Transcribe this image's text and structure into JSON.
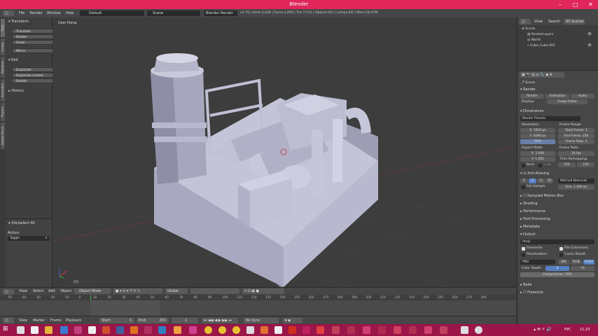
{
  "window": {
    "title": "Blender"
  },
  "topbar": {
    "menus": [
      "File",
      "Render",
      "Window",
      "Help"
    ],
    "layout": "Default",
    "scene": "Scene",
    "engine": "Blender Render",
    "stats": "v2.79 | Verts:3,426 | Faces:3,056 | Tris:7,512 | Objects:0/1 | Lamps:0/0 | Mem:18.47M"
  },
  "left_tabs": [
    "Tools",
    "Create",
    "Relations",
    "Animation",
    "Physics",
    "Grease Pencil"
  ],
  "toolshelf": {
    "transform_header": "Transform",
    "transform_buttons": [
      "Translate",
      "Rotate",
      "Scale"
    ],
    "mirror": "Mirror",
    "edit_header": "Edit",
    "edit_buttons": [
      "Duplicate",
      "Duplicate Linked",
      "Delete"
    ],
    "history_header": "History",
    "operator_header": "(De)select All",
    "action_label": "Action:",
    "action_value": "Toggle"
  },
  "viewport": {
    "label": "User Persp",
    "frame_indicator": "(1)"
  },
  "view3d_header": {
    "menus": [
      "View",
      "Select",
      "Add",
      "Object"
    ],
    "mode": "Object Mode",
    "orientation": "Global"
  },
  "timeline": {
    "ticks": [
      "-50",
      "-40",
      "-30",
      "-20",
      "-10",
      "0",
      "10",
      "20",
      "30",
      "40",
      "50",
      "60",
      "70",
      "80",
      "90",
      "100",
      "110",
      "120",
      "130",
      "140",
      "150",
      "160",
      "170",
      "180",
      "190",
      "200",
      "210",
      "220",
      "230",
      "240",
      "250",
      "260",
      "270",
      "280"
    ],
    "menus": [
      "View",
      "Marker",
      "Frame",
      "Playback"
    ],
    "start": "Start:",
    "start_val": "1",
    "end": "End:",
    "end_val": "250",
    "current": "1",
    "sync": "No Sync"
  },
  "outliner": {
    "menus": [
      "View",
      "Search",
      "All Scenes"
    ],
    "items": [
      "Scene",
      "RenderLayers",
      "World",
      "Cube_Cube.001"
    ]
  },
  "properties": {
    "context": "Scene",
    "render_header": "Render",
    "render_buttons": [
      "Render",
      "Animation",
      "Audio"
    ],
    "display_label": "Display:",
    "display_value": "Image Editor",
    "dimensions_header": "Dimensions",
    "render_presets": "Render Presets",
    "resolution_label": "Resolution:",
    "res_x": "1920 px",
    "res_y": "1080 px",
    "res_pct": "50%",
    "frame_range_label": "Frame Range:",
    "start_frame": "Start Frame:",
    "start_frame_val": "1",
    "end_frame": "End Frame:",
    "end_frame_val": "250",
    "frame_step": "Frame Step:",
    "frame_step_val": "1",
    "aspect_label": "Aspect Ratio:",
    "aspect_x": "1.000",
    "aspect_y": "1.000",
    "frame_rate_label": "Frame Rate:",
    "frame_rate": "24 fps",
    "time_remap": "Time Remapping:",
    "remap_old": "100",
    "remap_new": "100",
    "border": "Bord",
    "crop": "Crop",
    "aa_header": "Anti-Aliasing",
    "aa_samples": [
      "5",
      "8",
      "11",
      "16"
    ],
    "aa_filter": "Mitchell-Netravali",
    "full_sample": "Full Sample",
    "aa_size": "Size:",
    "aa_size_val": "1.000 px",
    "collapsed_panels": [
      "Sampled Motion Blur",
      "Shading",
      "Performance",
      "Post Processing",
      "Metadata"
    ],
    "output_header": "Output",
    "output_path": "/tmp\\",
    "overwrite": "Overwrite",
    "file_ext": "File Extensions",
    "placeholders": "Placeholders",
    "cache_result": "Cache Result",
    "format": "PNG",
    "color_modes": [
      "BW",
      "RGB",
      "RGBA"
    ],
    "color_depth_label": "Color Depth:",
    "color_depths": [
      "8",
      "16"
    ],
    "compression_label": "Compression:",
    "compression_val": "15%",
    "bottom_panels": [
      "Bake",
      "Freestyle"
    ]
  },
  "taskbar": {
    "lang": "РУС",
    "time": "11:23"
  },
  "colors": {
    "title_bar": "#e0265a",
    "taskbar": "#9b1548",
    "accent_blue": "#5680c2"
  }
}
